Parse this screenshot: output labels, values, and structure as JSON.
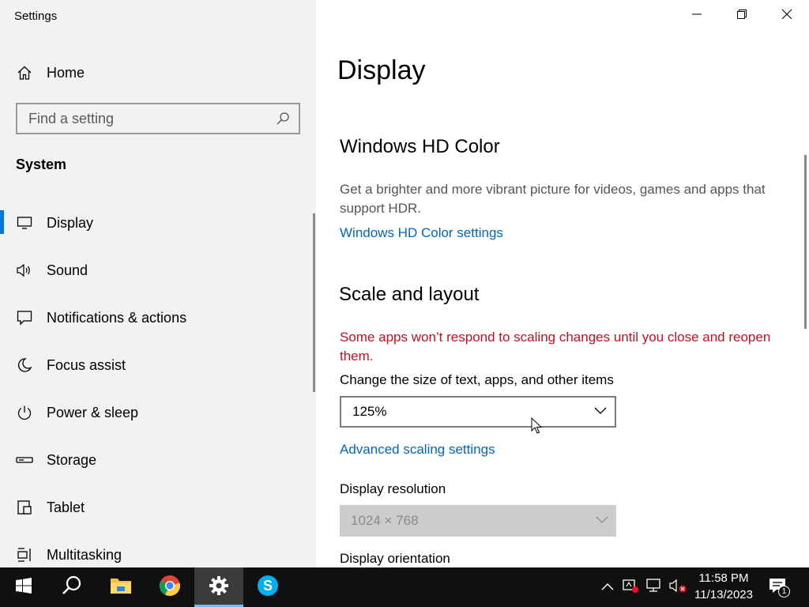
{
  "window": {
    "title": "Settings",
    "minimize_icon": "minimize-icon",
    "maximize_icon": "restore-icon",
    "close_icon": "close-icon"
  },
  "sidebar": {
    "home_label": "Home",
    "search": {
      "placeholder": "Find a setting",
      "value": ""
    },
    "section": "System",
    "items": [
      {
        "label": "Display",
        "icon": "monitor-icon",
        "selected": true
      },
      {
        "label": "Sound",
        "icon": "speaker-icon"
      },
      {
        "label": "Notifications & actions",
        "icon": "notification-icon"
      },
      {
        "label": "Focus assist",
        "icon": "moon-icon"
      },
      {
        "label": "Power & sleep",
        "icon": "power-icon"
      },
      {
        "label": "Storage",
        "icon": "storage-icon"
      },
      {
        "label": "Tablet",
        "icon": "tablet-icon"
      },
      {
        "label": "Multitasking",
        "icon": "multitasking-icon"
      }
    ]
  },
  "main": {
    "title": "Display",
    "hdr": {
      "heading": "Windows HD Color",
      "description": "Get a brighter and more vibrant picture for videos, games and apps that support HDR.",
      "link": "Windows HD Color settings"
    },
    "scale": {
      "heading": "Scale and layout",
      "warning": "Some apps won’t respond to scaling changes until you close and reopen them.",
      "size_label": "Change the size of text, apps, and other items",
      "size_value": "125%",
      "advanced_link": "Advanced scaling settings",
      "resolution_label": "Display resolution",
      "resolution_value": "1024 × 768",
      "orientation_label": "Display orientation"
    }
  },
  "taskbar": {
    "apps": [
      "start-button",
      "search-button",
      "file-explorer",
      "chrome",
      "settings",
      "skype"
    ],
    "active_app": "settings",
    "time": "11:58 PM",
    "date": "11/13/2023",
    "notification_count": "1"
  },
  "colors": {
    "accent": "#0078d7",
    "link": "#0067c0",
    "warning": "#c50f1f",
    "sidebar_bg": "#f2f2f2",
    "taskbar_bg": "#101010"
  }
}
